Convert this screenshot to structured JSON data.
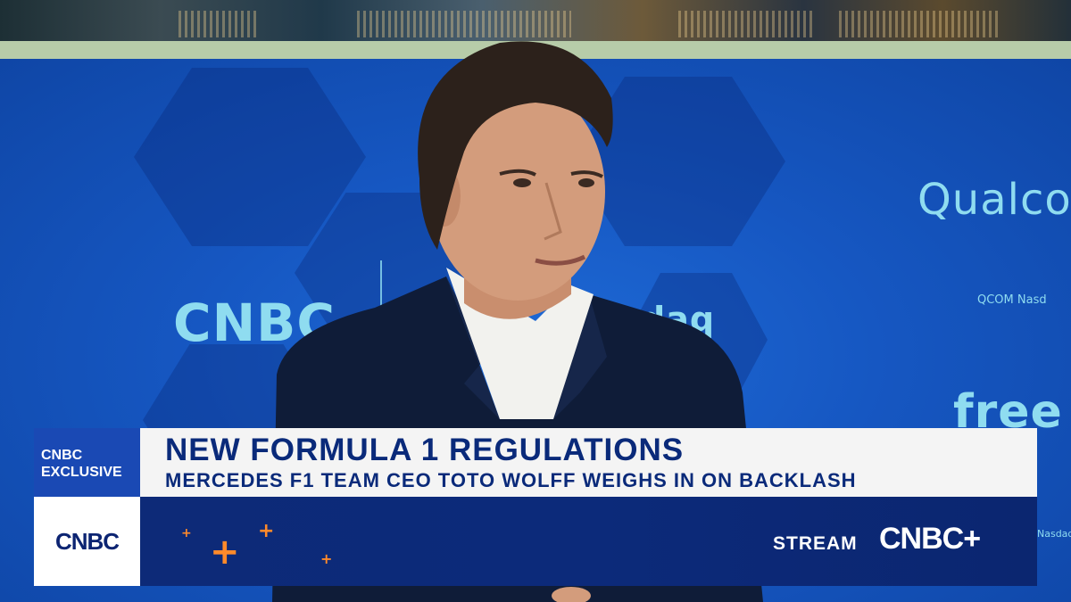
{
  "background": {
    "wall_logo_left": "CNBC",
    "wall_logo_right": "Qualco",
    "wall_ticker_text": "QCOM Nasd",
    "wall_partial_text_1": "daq",
    "wall_partial_text_2": "free",
    "wall_partial_text_3": "Nasdaq"
  },
  "lower_third": {
    "tag_line1": "CNBC",
    "tag_line2": "EXCLUSIVE",
    "headline": "NEW FORMULA 1 REGULATIONS",
    "subheadline": "MERCEDES F1 TEAM CEO TOTO WOLFF WEIGHS IN ON BACKLASH",
    "network_logo": "CNBC",
    "stream_label": "STREAM",
    "stream_brand": "CNBC+"
  },
  "colors": {
    "brand_blue": "#1a49b4",
    "navy": "#0c2a7a",
    "accent_orange": "#ff8a2a",
    "wall_blue": "#1657c2"
  }
}
